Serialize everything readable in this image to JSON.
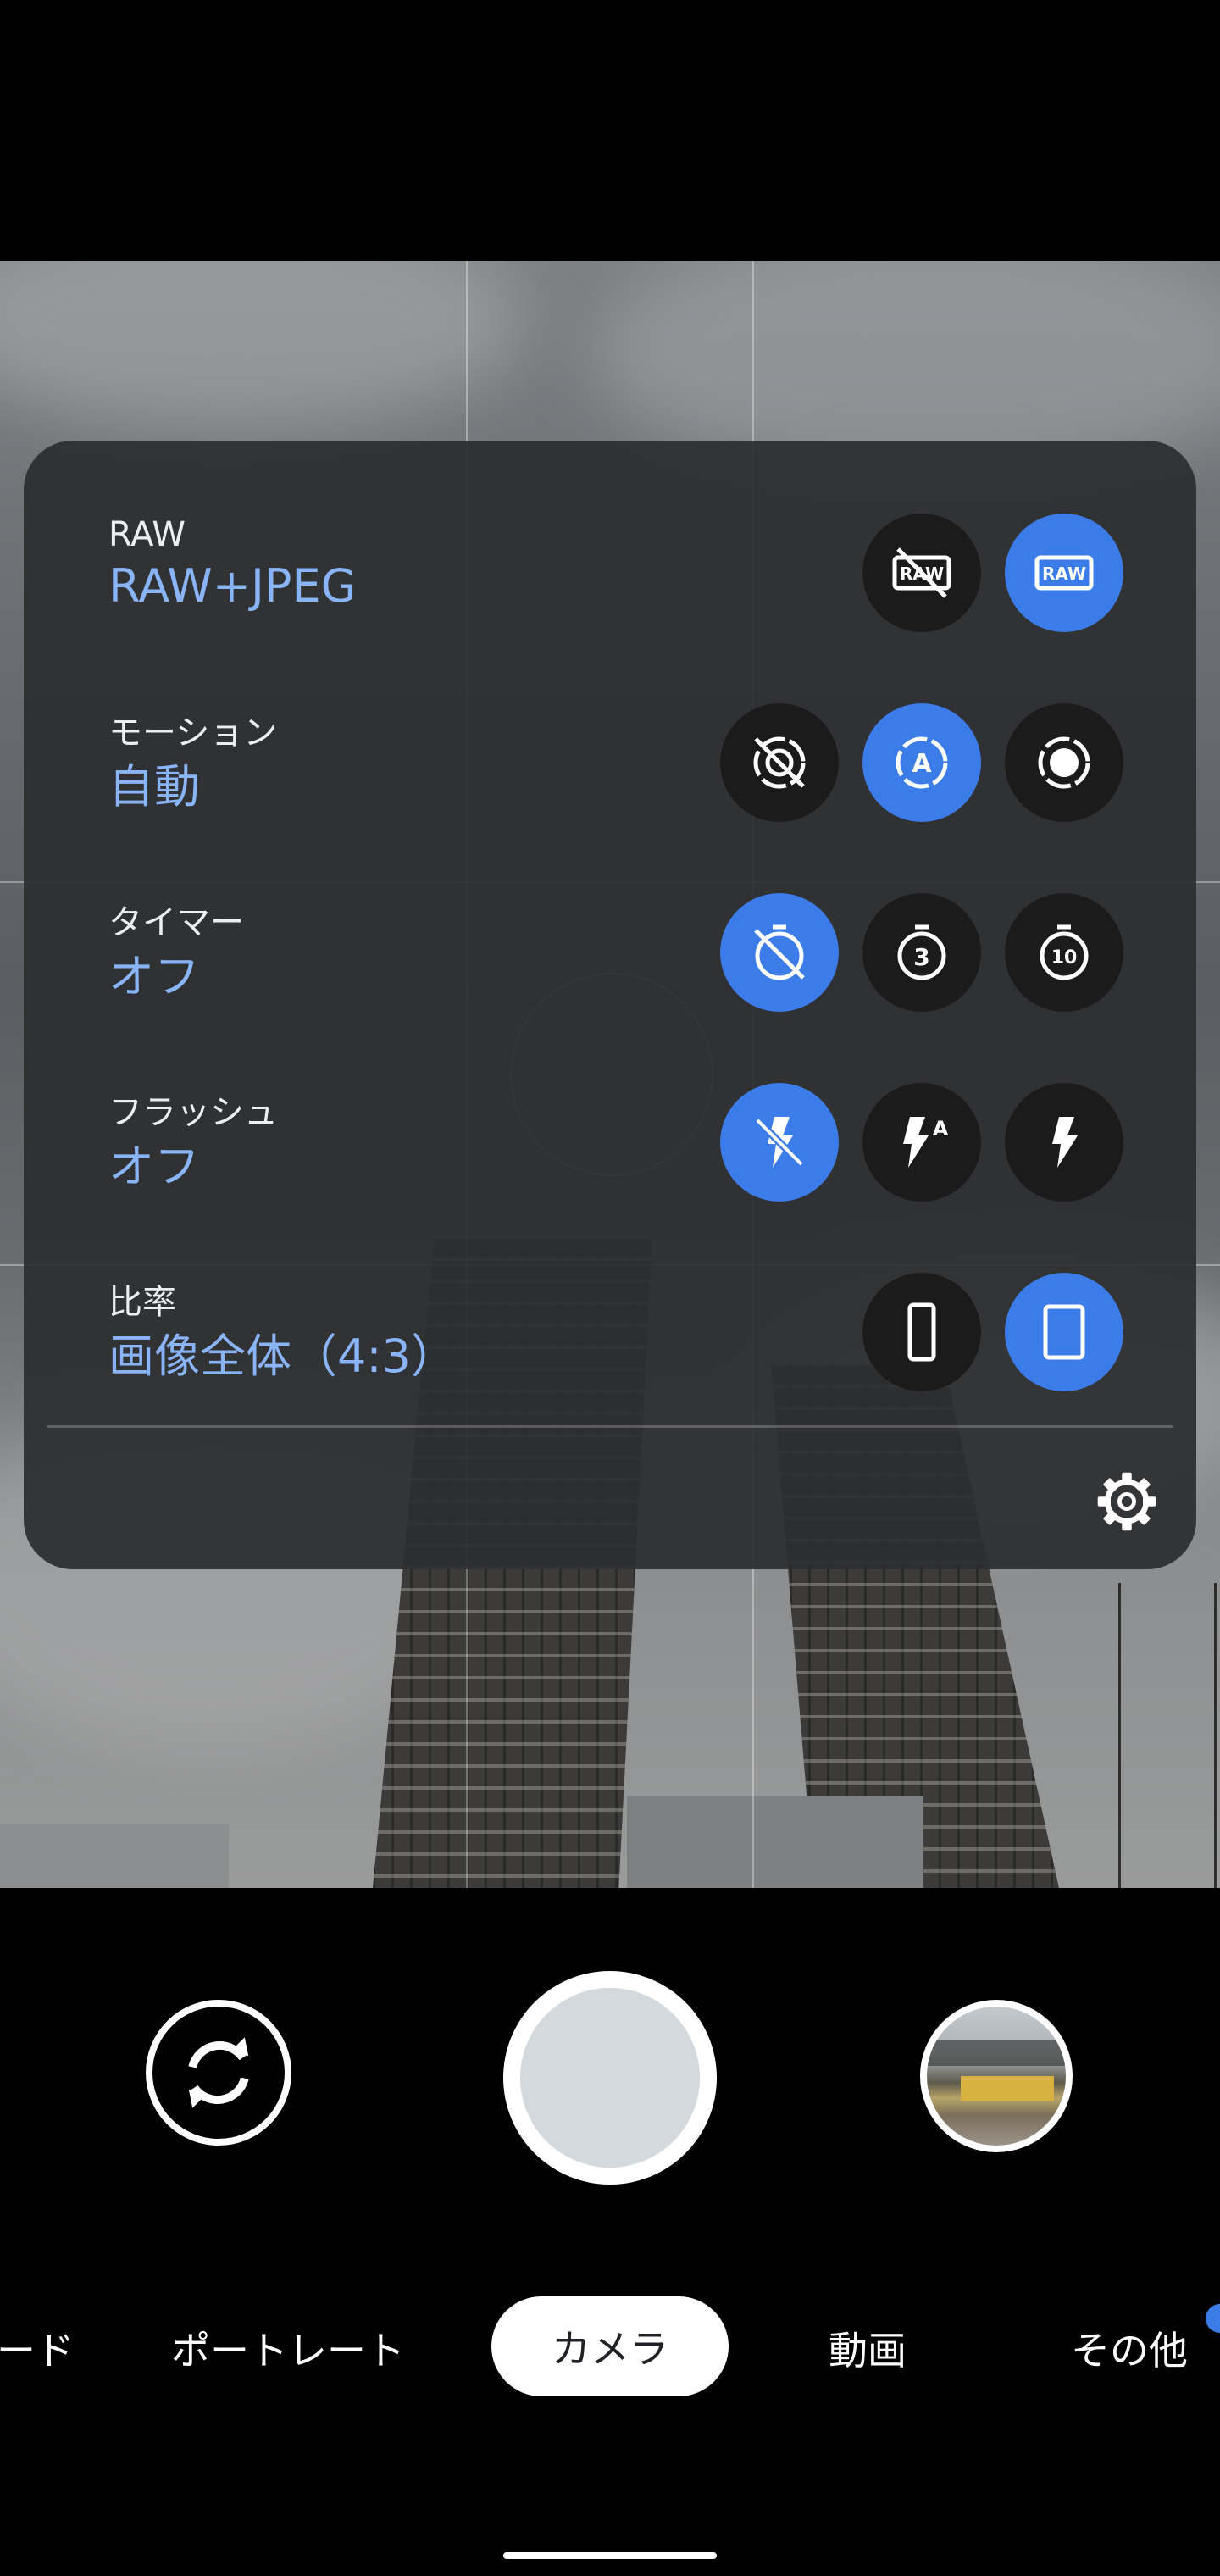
{
  "panel": {
    "rows": [
      {
        "label": "RAW",
        "value": "RAW+JPEG"
      },
      {
        "label": "モーション",
        "value": "自動"
      },
      {
        "label": "タイマー",
        "value": "オフ"
      },
      {
        "label": "フラッシュ",
        "value": "オフ"
      },
      {
        "label": "比率",
        "value": "画像全体（4:3）"
      }
    ],
    "options": {
      "raw": [
        "raw-off-icon",
        "raw-on-icon"
      ],
      "raw_selected": 1,
      "motion": [
        "motion-off-icon",
        "motion-auto-icon",
        "motion-on-icon"
      ],
      "motion_selected": 1,
      "timer": [
        "timer-off-icon",
        "timer-3s-icon",
        "timer-10s-icon"
      ],
      "timer_selected": 0,
      "flash": [
        "flash-off-icon",
        "flash-auto-icon",
        "flash-on-icon"
      ],
      "flash_selected": 0,
      "ratio": [
        "ratio-16-9-icon",
        "ratio-4-3-icon"
      ],
      "ratio_selected": 1,
      "raw_icon_text": "RAW",
      "timer3_text": "3",
      "timer10_text": "10",
      "flash_auto_text": "A",
      "motion_auto_text": "A"
    }
  },
  "modes": {
    "items": [
      "ード",
      "ポートレート",
      "カメラ",
      "動画",
      "その他"
    ],
    "selected": "カメラ"
  },
  "colors": {
    "accent": "#3b7ce8",
    "value_text": "#8ab4f8",
    "panel_bg": "#2c2d2f",
    "shutter_inner": "#d3d9dc"
  }
}
